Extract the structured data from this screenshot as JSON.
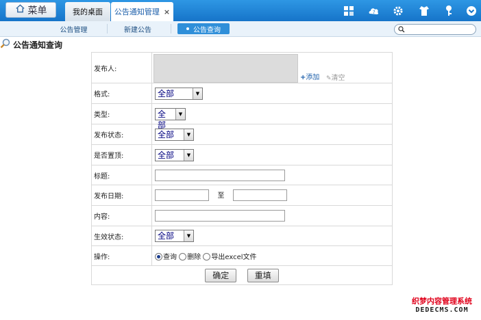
{
  "topbar": {
    "menu_label": "菜单",
    "tabs": [
      {
        "label": "我的桌面"
      },
      {
        "label": "公告通知管理",
        "close": "×"
      }
    ],
    "icons": [
      "grid-icon",
      "help-icon",
      "gear-icon",
      "shirt-icon",
      "key-icon",
      "chevron-down-icon"
    ]
  },
  "subnav": {
    "items": [
      {
        "label": "公告管理"
      },
      {
        "label": "新建公告"
      },
      {
        "label": "公告查询"
      }
    ]
  },
  "search": {
    "placeholder": ""
  },
  "page_title": "公告通知查询",
  "form": {
    "publisher": {
      "label": "发布人:",
      "add": "添加",
      "clear": "清空"
    },
    "format": {
      "label": "格式:",
      "value": "全部"
    },
    "type": {
      "label": "类型:",
      "value": "全部"
    },
    "status": {
      "label": "发布状态:",
      "value": "全部"
    },
    "pinned": {
      "label": "是否置顶:",
      "value": "全部"
    },
    "title": {
      "label": "标题:",
      "value": ""
    },
    "date": {
      "label": "发布日期:",
      "to": "至",
      "from_value": "",
      "to_value": ""
    },
    "content": {
      "label": "内容:",
      "value": ""
    },
    "effective": {
      "label": "生效状态:",
      "value": "全部"
    },
    "operation": {
      "label": "操作:",
      "options": [
        {
          "label": "查询",
          "checked": true
        },
        {
          "label": "删除",
          "checked": false
        },
        {
          "label": "导出excel文件",
          "checked": false
        }
      ]
    },
    "buttons": {
      "confirm": "确定",
      "reset": "重填"
    }
  },
  "watermark": {
    "line1": "织梦内容管理系统",
    "line2": "DEDECMS.COM"
  },
  "colors": {
    "topbar": "#1a7fd4",
    "accent": "#2f8fd9",
    "link": "#1b5eaa",
    "watermark_red": "#e0001a"
  }
}
